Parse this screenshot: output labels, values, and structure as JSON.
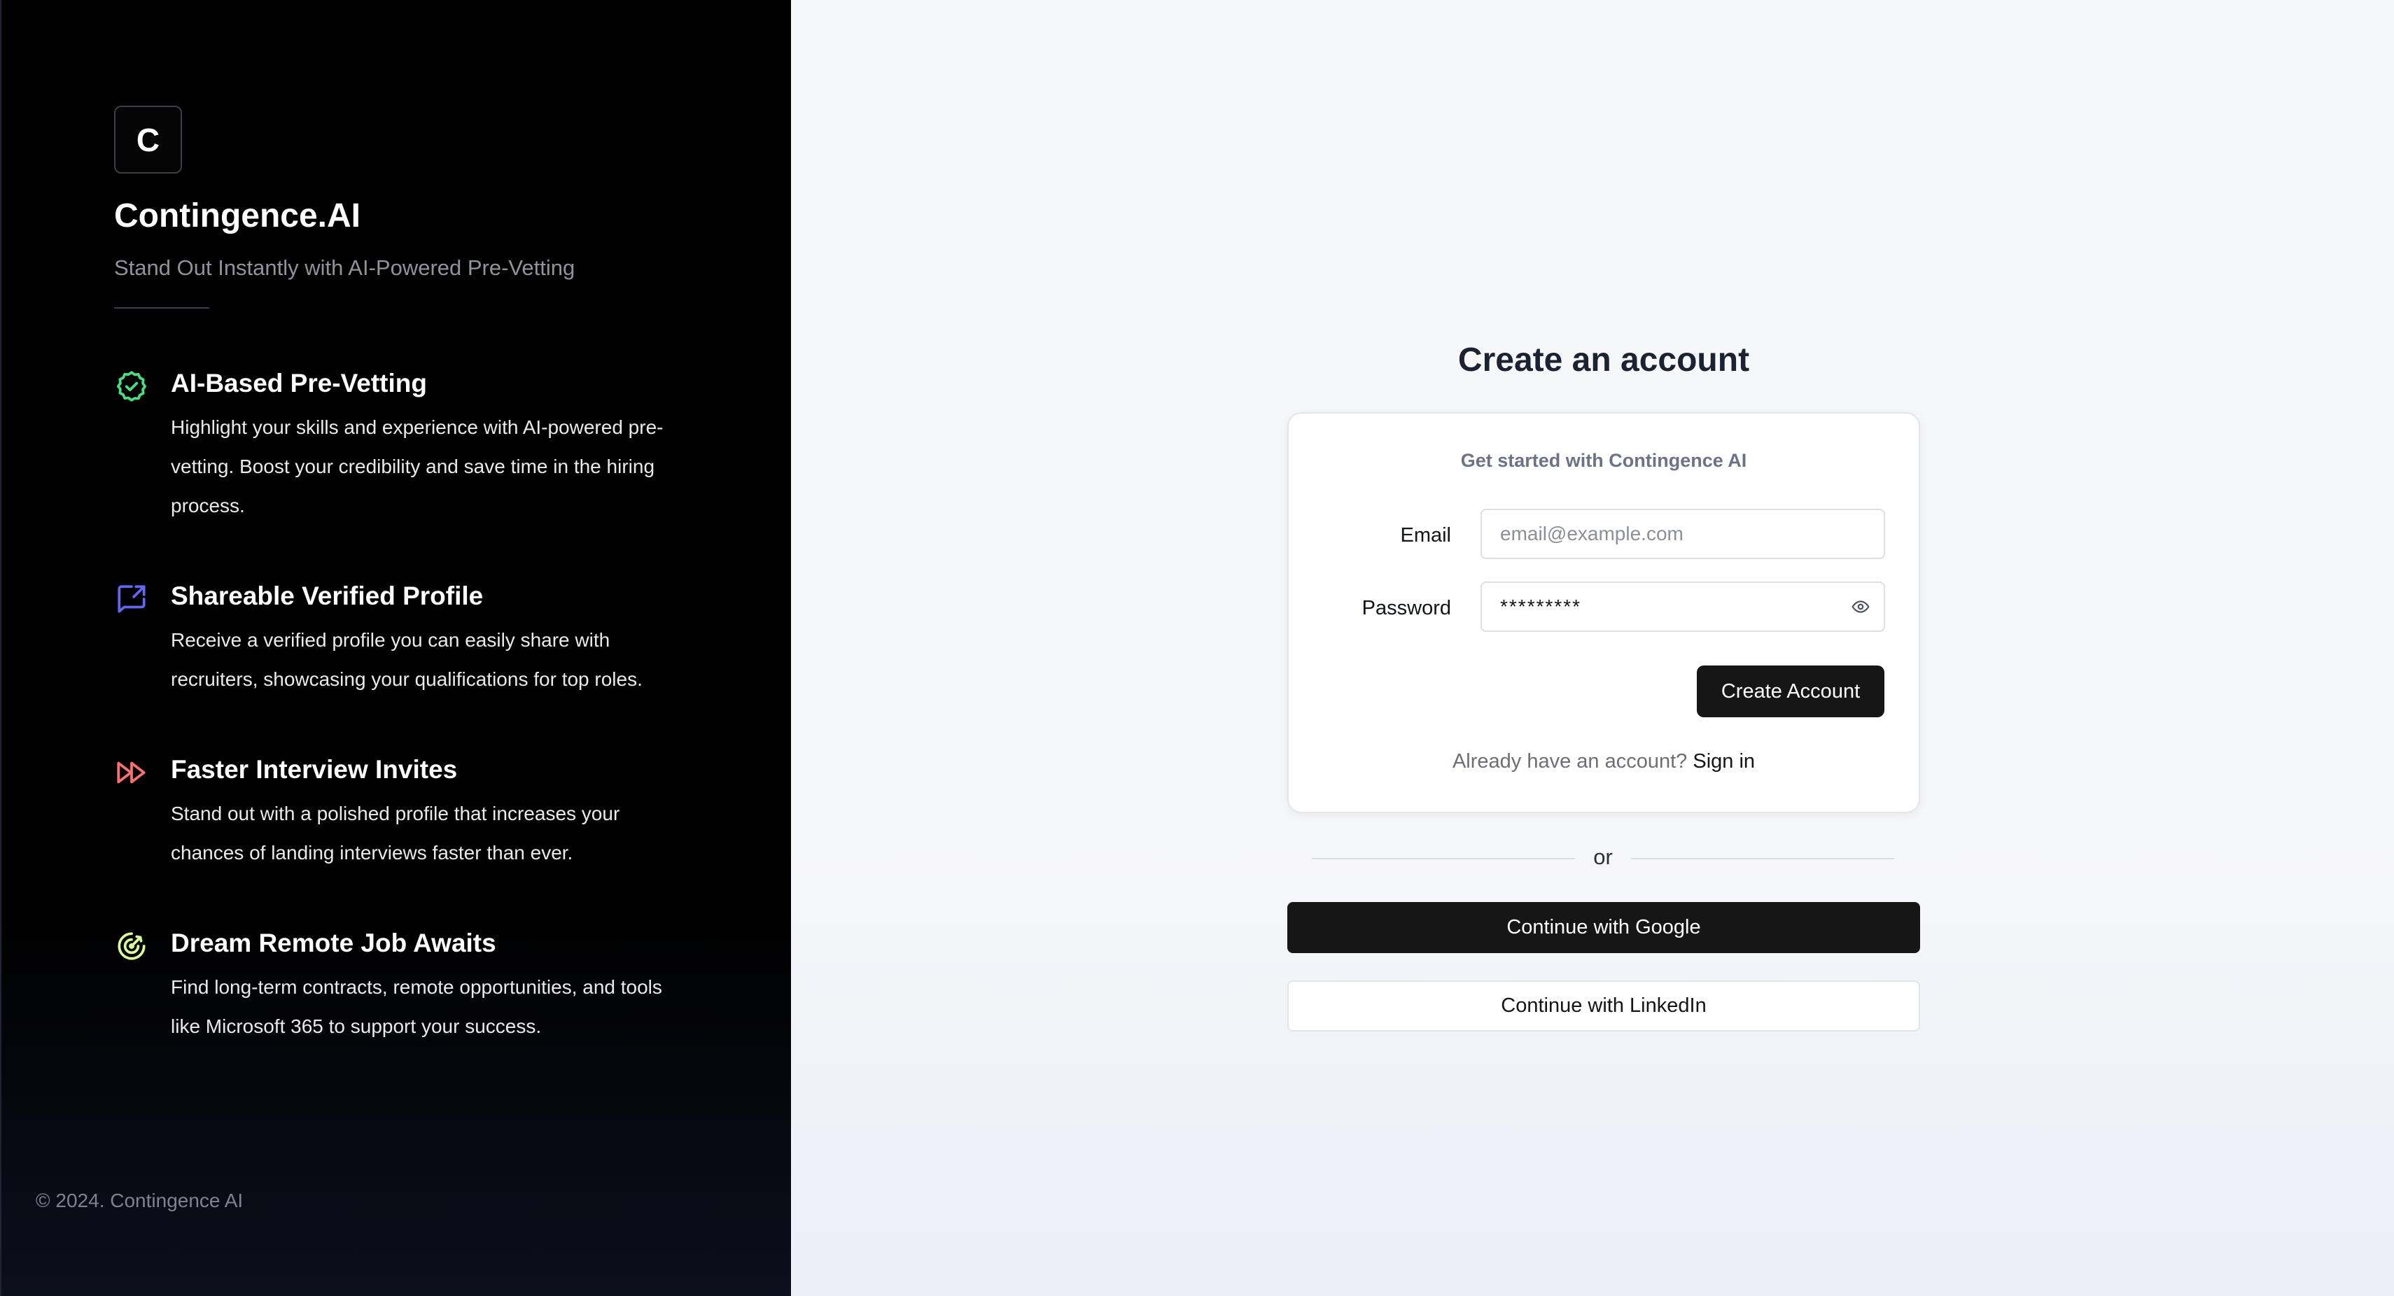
{
  "brand": {
    "logo_letter": "C",
    "name": "Contingence.AI",
    "tagline": "Stand Out Instantly with AI-Powered Pre-Vetting"
  },
  "features": [
    {
      "icon": "badge-check-icon",
      "icon_color": "#4ade80",
      "title": "AI-Based Pre-Vetting",
      "description": "Highlight your skills and experience with AI-powered pre-vetting. Boost your credibility and save time in the hiring process."
    },
    {
      "icon": "share-external-icon",
      "icon_color": "#6366f1",
      "title": "Shareable Verified Profile",
      "description": "Receive a verified profile you can easily share with recruiters, showcasing your qualifications for top roles."
    },
    {
      "icon": "fast-forward-icon",
      "icon_color": "#f87171",
      "title": "Faster Interview Invites",
      "description": "Stand out with a polished profile that increases your chances of landing interviews faster than ever."
    },
    {
      "icon": "target-icon",
      "icon_color": "#d9f99d",
      "title": "Dream Remote Job Awaits",
      "description": "Find long-term contracts, remote opportunities, and tools like Microsoft 365 to support your success."
    }
  ],
  "footer": {
    "copyright": "© 2024. Contingence AI"
  },
  "signup": {
    "heading": "Create an account",
    "subheading": "Get started with Contingence AI",
    "email_label": "Email",
    "email_placeholder": "email@example.com",
    "password_label": "Password",
    "password_value": "*********",
    "create_button": "Create Account",
    "already_text": "Already have an account?",
    "sign_in_link": "Sign in",
    "or_text": "or",
    "google_button": "Continue with Google",
    "linkedin_button": "Continue with LinkedIn"
  }
}
